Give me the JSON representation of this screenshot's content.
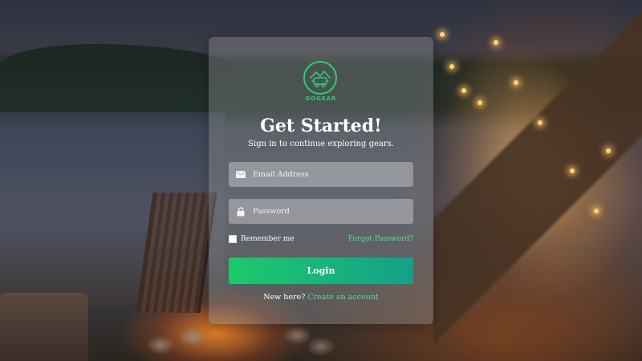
{
  "brand": {
    "name": "GOGEAR",
    "color": "#2ecc71"
  },
  "heading": {
    "title": "Get Started!",
    "subtitle": "Sign in to continue exploring gears."
  },
  "form": {
    "email": {
      "placeholder": "Email Address",
      "value": "",
      "icon": "envelope-icon"
    },
    "password": {
      "placeholder": "Password",
      "value": "",
      "icon": "lock-icon"
    },
    "remember_label": "Remember me",
    "remember_checked": false,
    "forgot_label": "Forgot Password?",
    "login_label": "Login"
  },
  "footer": {
    "prompt": "New here?",
    "link_label": "Create an account"
  },
  "colors": {
    "accent": "#52e08a",
    "button_start": "#1dc96b",
    "button_end": "#14a08a"
  }
}
